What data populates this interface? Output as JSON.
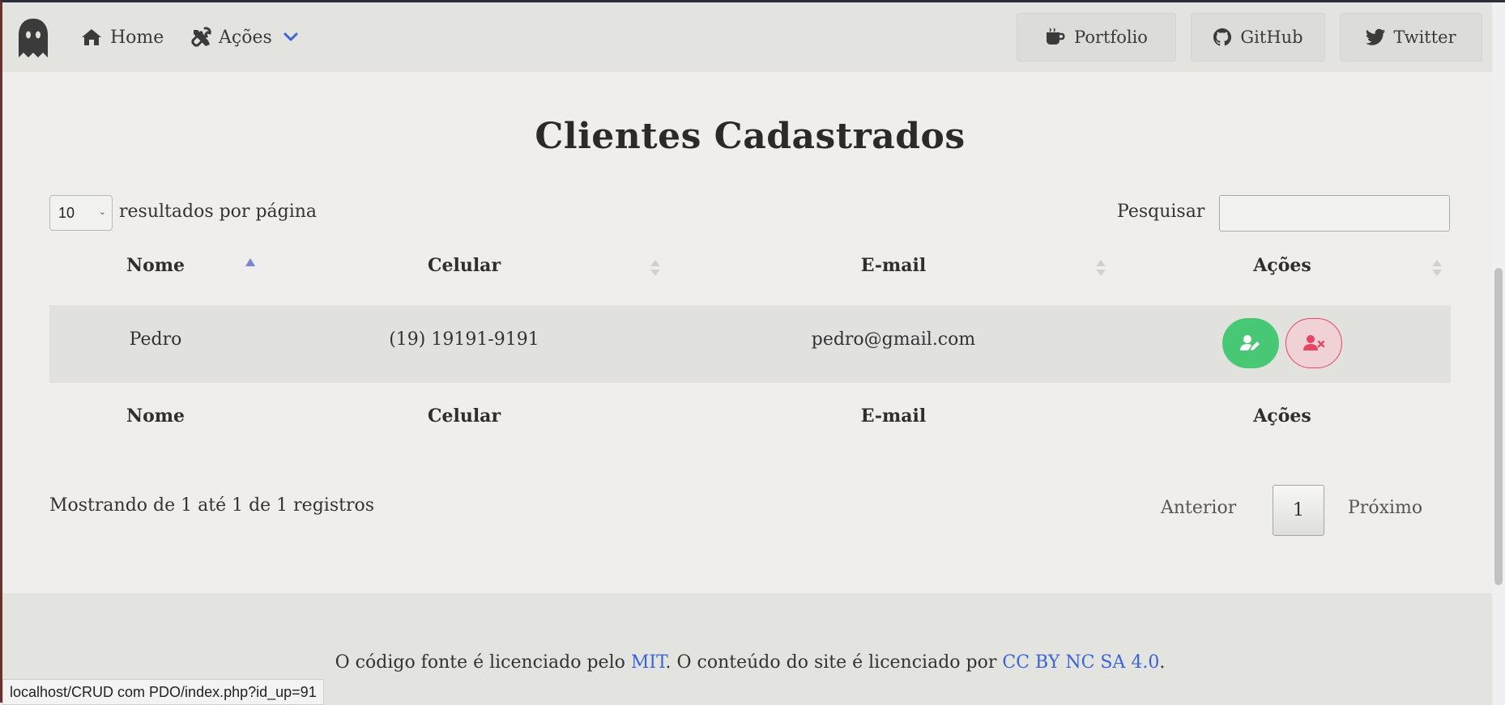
{
  "nav": {
    "home_label": "Home",
    "acoes_label": "Ações",
    "portfolio_label": "Portfolio",
    "github_label": "GitHub",
    "twitter_label": "Twitter"
  },
  "page": {
    "title": "Clientes Cadastrados"
  },
  "table_controls": {
    "page_length": "10",
    "length_label": "resultados por página",
    "search_label": "Pesquisar",
    "search_value": ""
  },
  "table": {
    "columns": [
      "Nome",
      "Celular",
      "E-mail",
      "Ações"
    ],
    "sort_column": "Nome",
    "sort_direction": "ascending",
    "rows": [
      {
        "nome": "Pedro",
        "celular": "(19) 19191-9191",
        "email": "pedro@gmail.com"
      }
    ]
  },
  "pagination": {
    "info": "Mostrando de 1 até 1 de 1 registros",
    "prev_label": "Anterior",
    "current_page": "1",
    "next_label": "Próximo"
  },
  "footer": {
    "text_part1": "O código fonte é licenciado pelo ",
    "link_mit": "MIT",
    "text_part2": ". O conteúdo do site é licenciado por ",
    "link_cc": "CC BY NC SA 4.0",
    "text_part3": "."
  },
  "status_bar": {
    "url": "localhost/CRUD com PDO/index.php?id_up=91"
  },
  "colors": {
    "accent_blue": "#3a63d8",
    "edit_green": "#48c774",
    "delete_red": "#e84562",
    "sort_active": "#7c84d6"
  }
}
